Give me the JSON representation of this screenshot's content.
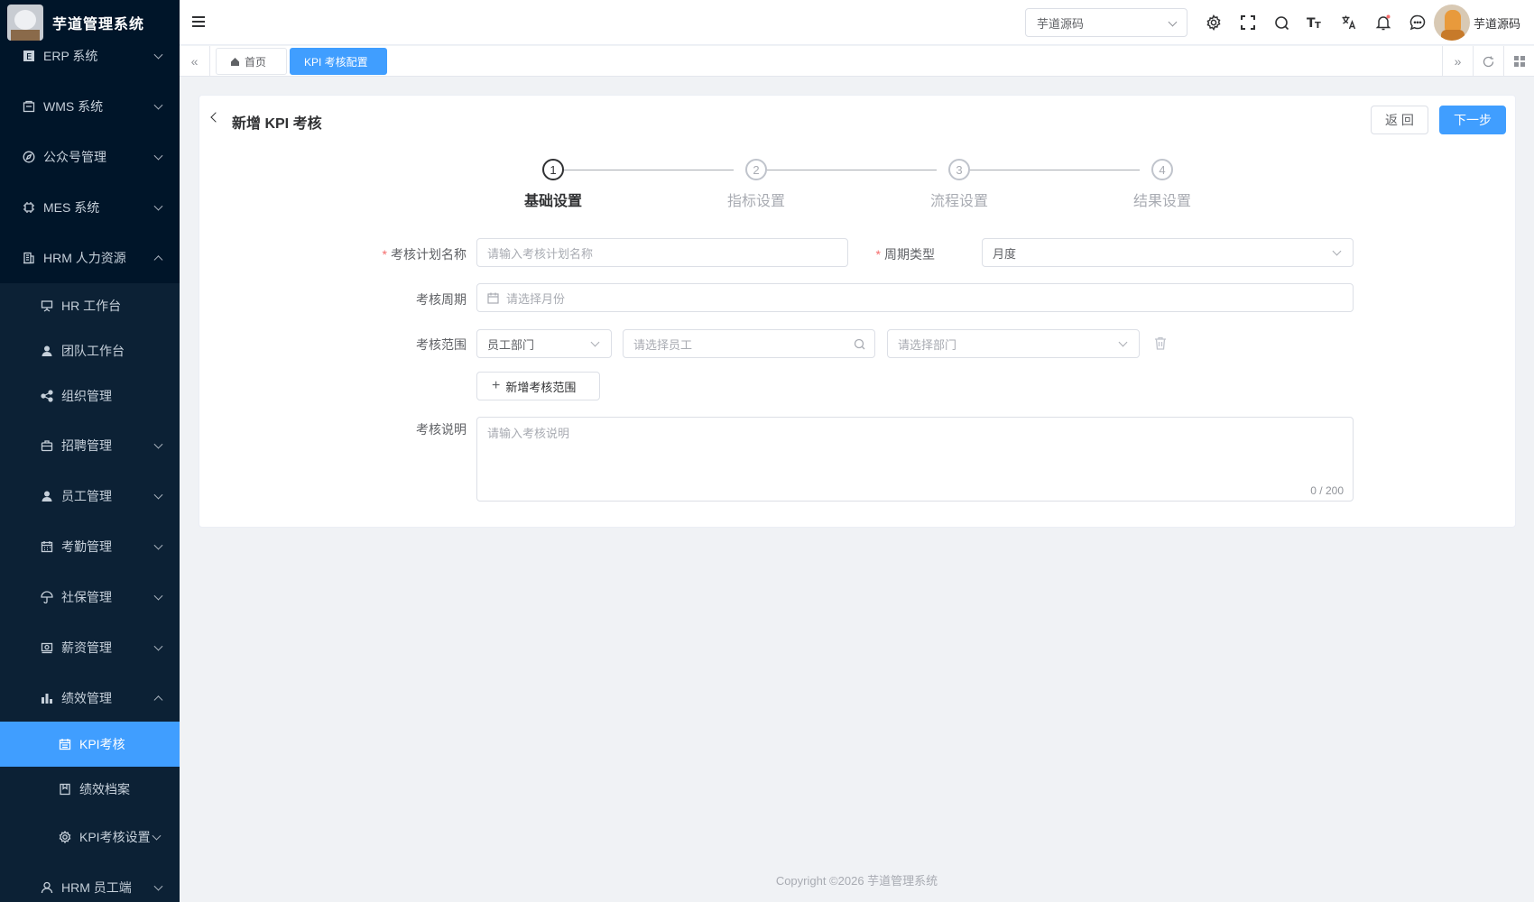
{
  "brand": {
    "title": "芋道管理系统"
  },
  "sidebar": {
    "items": [
      {
        "label": "ERP 系统",
        "icon": "erp-icon"
      },
      {
        "label": "WMS 系统",
        "icon": "box-icon"
      },
      {
        "label": "公众号管理",
        "icon": "compass-icon"
      },
      {
        "label": "MES 系统",
        "icon": "chip-icon"
      },
      {
        "label": "HRM 人力资源",
        "icon": "building-icon"
      },
      {
        "label": "HR 工作台",
        "icon": "board-icon"
      },
      {
        "label": "团队工作台",
        "icon": "user-icon"
      },
      {
        "label": "组织管理",
        "icon": "share-icon"
      },
      {
        "label": "招聘管理",
        "icon": "briefcase-icon"
      },
      {
        "label": "员工管理",
        "icon": "user-icon"
      },
      {
        "label": "考勤管理",
        "icon": "calendar-icon"
      },
      {
        "label": "社保管理",
        "icon": "umbrella-icon"
      },
      {
        "label": "薪资管理",
        "icon": "money-icon"
      },
      {
        "label": "绩效管理",
        "icon": "bar-chart-icon"
      },
      {
        "label": "KPI考核",
        "icon": "calendar-icon"
      },
      {
        "label": "绩效档案",
        "icon": "file-icon"
      },
      {
        "label": "KPI考核设置",
        "icon": "gear-icon"
      },
      {
        "label": "HRM 员工端",
        "icon": "user-icon"
      }
    ]
  },
  "header": {
    "tenant": "芋道源码",
    "username": "芋道源码"
  },
  "tabs": {
    "home": "首页",
    "active": "KPI 考核配置"
  },
  "page": {
    "title": "新增 KPI 考核",
    "back_label": "返 回",
    "next_label": "下一步"
  },
  "steps": [
    {
      "num": "1",
      "label": "基础设置"
    },
    {
      "num": "2",
      "label": "指标设置"
    },
    {
      "num": "3",
      "label": "流程设置"
    },
    {
      "num": "4",
      "label": "结果设置"
    }
  ],
  "form": {
    "name_label": "考核计划名称",
    "name_placeholder": "请输入考核计划名称",
    "cycle_type_label": "周期类型",
    "cycle_type_value": "月度",
    "period_label": "考核周期",
    "period_placeholder": "请选择月份",
    "scope_label": "考核范围",
    "scope_type_value": "员工部门",
    "employee_placeholder": "请选择员工",
    "dept_placeholder": "请选择部门",
    "add_scope_label": "新增考核范围",
    "desc_label": "考核说明",
    "desc_placeholder": "请输入考核说明",
    "desc_counter": "0 / 200"
  },
  "footer": {
    "copyright": "Copyright ©2026 芋道管理系统"
  },
  "colors": {
    "primary": "#409eff",
    "sidebar": "#001529",
    "required": "#f56c6c"
  }
}
